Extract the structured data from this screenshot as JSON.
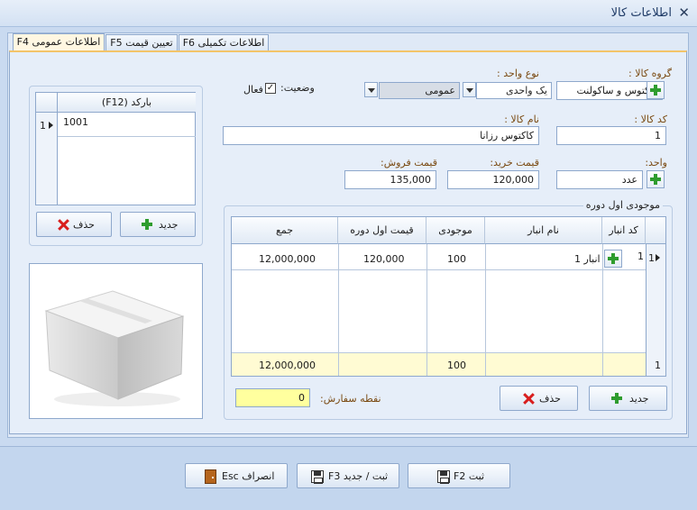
{
  "window": {
    "title": "اطلاعات کالا",
    "close_glyph": "✕"
  },
  "tabs": [
    {
      "label": "اطلاعات عمومی F4",
      "active": true
    },
    {
      "label": "تعیین قیمت F5",
      "active": false
    },
    {
      "label": "اطلاعات تکمیلی F6",
      "active": false
    }
  ],
  "form": {
    "group_label": "گروه کالا :",
    "group_value": "کاکتوس و ساکولنت",
    "unit_type_label": "نوع واحد :",
    "unit_type_value": "یک واحدی",
    "general_value": "عمومی",
    "status_label": "وضعیت:",
    "active_label": "فعال",
    "active_checked": "✓",
    "code_label": "کد کالا :",
    "code_value": "1",
    "name_label": "نام کالا :",
    "name_value": "کاکتوس رزانا",
    "unit_label": "واحد:",
    "unit_value": "عدد",
    "buy_price_label": "قیمت خرید:",
    "buy_price_value": "120,000",
    "sell_price_label": "قیمت فروش:",
    "sell_price_value": "135,000"
  },
  "barcode": {
    "header": "(F12) بارکد",
    "row_num": "1",
    "value": "1001",
    "new_label": "جدید",
    "delete_label": "حذف"
  },
  "stock": {
    "group_label": "موجودی اول دوره",
    "columns": [
      "کد انبار",
      "نام انبار",
      "موجودی",
      "قیمت اول دوره",
      "جمع"
    ],
    "row": {
      "num": "1",
      "code": "1",
      "name": "انبار 1",
      "qty": "100",
      "price": "120,000",
      "total": "12,000,000"
    },
    "footer": {
      "num": "1",
      "qty": "100",
      "total": "12,000,000"
    },
    "reorder_label": "نقطه سفارش:",
    "reorder_value": "0",
    "new_label": "جدید",
    "delete_label": "حذف"
  },
  "footer_buttons": {
    "save": "ثبت F2",
    "save_new": "ثبت / جدید F3",
    "cancel": "انصراف Esc"
  }
}
